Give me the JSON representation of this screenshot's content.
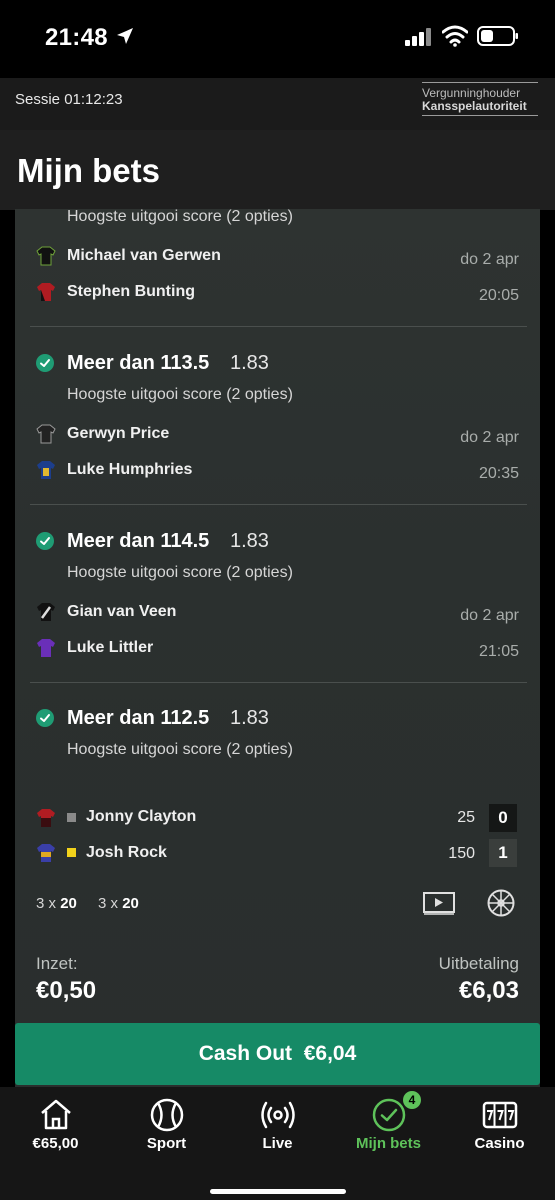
{
  "status_bar": {
    "time": "21:48"
  },
  "session": {
    "label": "Sessie 01:12:23",
    "license_line1": "Vergunninghouder",
    "license_line2": "Kansspelautoriteit"
  },
  "header": {
    "title": "Mijn bets"
  },
  "legs": [
    {
      "selection": "",
      "odds": "",
      "market": "Hoogste uitgooi score (2 opties)",
      "player1": "Michael van Gerwen",
      "player2": "Stephen Bunting",
      "date": "do 2 apr",
      "time": "20:05"
    },
    {
      "selection": "Meer dan 113.5",
      "odds": "1.83",
      "market": "Hoogste uitgooi score (2 opties)",
      "player1": "Gerwyn Price",
      "player2": "Luke Humphries",
      "date": "do 2 apr",
      "time": "20:35"
    },
    {
      "selection": "Meer dan 114.5",
      "odds": "1.83",
      "market": "Hoogste uitgooi score (2 opties)",
      "player1": "Gian van Veen",
      "player2": "Luke Littler",
      "date": "do 2 apr",
      "time": "21:05"
    },
    {
      "selection": "Meer dan 112.5",
      "odds": "1.83",
      "market": "Hoogste uitgooi score (2 opties)",
      "player1": "Jonny Clayton",
      "player2": "Josh Rock",
      "p1_legs": "25",
      "p1_sets": "0",
      "p2_legs": "150",
      "p2_sets": "1",
      "stat1_prefix": "3 x",
      "stat1_value": "20",
      "stat2_prefix": "3 x",
      "stat2_value": "20"
    }
  ],
  "summary": {
    "stake_label": "Inzet:",
    "stake_value": "€0,50",
    "payout_label": "Uitbetaling",
    "payout_value": "€6,03"
  },
  "cashout": {
    "label": "Cash Out",
    "amount": "€6,04"
  },
  "tabbar": {
    "balance": "€65,00",
    "sport": "Sport",
    "live": "Live",
    "mybets": "Mijn bets",
    "mybets_badge": "4",
    "casino": "Casino"
  },
  "colors": {
    "accent": "#168a66",
    "active_tab": "#5ec25a",
    "check": "#1f9c74"
  },
  "icons": [
    "location-arrow-icon",
    "signal-icon",
    "wifi-icon",
    "battery-icon",
    "check-circle-icon",
    "shirt-icon",
    "play-video-icon",
    "dartboard-icon",
    "home-icon",
    "sport-ball-icon",
    "live-broadcast-icon",
    "check-circle-tab-icon",
    "casino-slot-icon"
  ]
}
